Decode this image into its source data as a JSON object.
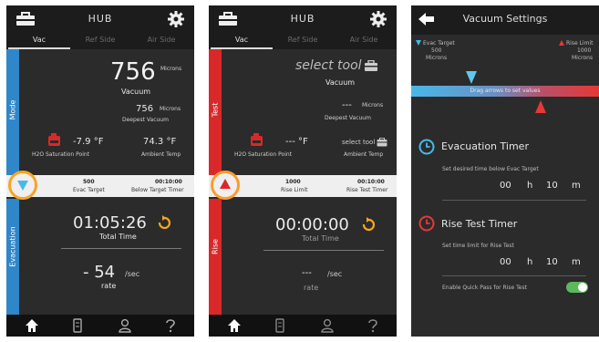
{
  "colors": {
    "vac_blue": "#2f86c8",
    "test_red": "#d9282a",
    "accent_orange": "#f5a623",
    "background": "#2b2b2b",
    "toggle_green": "#5cb85c"
  },
  "screen1": {
    "header_title": "HUB",
    "tabs": [
      "Vac",
      "Ref Side",
      "Air Side"
    ],
    "vacuum_value": "756",
    "vacuum_unit": "Microns",
    "vacuum_label": "Vacuum",
    "deepest_value": "756",
    "deepest_unit": "Microns",
    "deepest_label": "Deepest Vacuum",
    "h2o_value": "-7.9 °F",
    "h2o_label": "H2O Saturation Point",
    "ambient_value": "74.3 °F",
    "ambient_label": "Ambient Temp",
    "band_left_value": "500",
    "band_left_label": "Evac Target",
    "band_right_value": "00:10:00",
    "band_right_label": "Below Target Timer",
    "mode_label": "Mode",
    "phase_label": "Evacuation",
    "total_time_value": "01:05:26",
    "total_time_label": "Total Time",
    "rate_value": "- 54",
    "rate_unit": "/sec",
    "rate_label": "rate"
  },
  "screen2": {
    "header_title": "HUB",
    "tabs": [
      "Vac",
      "Ref Side",
      "Air Side"
    ],
    "select_tool": "select tool",
    "vacuum_label": "Vacuum",
    "deepest_value": "---",
    "deepest_unit": "Microns",
    "deepest_label": "Deepest Vacuum",
    "h2o_value": "--- °F",
    "h2o_label": "H2O Saturation Point",
    "ambient_value": "select tool",
    "ambient_label": "Ambient Temp",
    "band_left_value": "1000",
    "band_left_label": "Rise Limit",
    "band_right_value": "00:10:00",
    "band_right_label": "Rise Test Timer",
    "test_label": "Test",
    "rise_label": "Rise",
    "total_time_value": "00:00:00",
    "total_time_label": "Total Time",
    "rate_value": "---",
    "rate_unit": "/sec",
    "rate_label": "rate"
  },
  "screen3": {
    "title": "Vacuum Settings",
    "evac_target_label": "Evac Target",
    "evac_target_value": "500",
    "evac_target_unit": "Microns",
    "rise_limit_label": "Rise Limit",
    "rise_limit_value": "1000",
    "rise_limit_unit": "Microns",
    "drag_hint": "Drag arrows to set values",
    "evac_timer_title": "Evacuation Timer",
    "evac_timer_desc": "Set desired time below Evac Target",
    "evac_hours": "00",
    "evac_h": "h",
    "evac_minutes": "10",
    "evac_m": "m",
    "rise_timer_title": "Rise Test Timer",
    "rise_timer_desc": "Set time limit for Rise Test",
    "rise_hours": "00",
    "rise_h": "h",
    "rise_minutes": "10",
    "rise_m": "m",
    "quick_pass_label": "Enable Quick Pass for Rise Test",
    "quick_pass_enabled": true
  },
  "icons": {
    "toolbox": "toolbox-icon",
    "gear": "gear-icon",
    "home": "home-icon",
    "gauge": "gauge-icon",
    "user": "user-icon",
    "help": "help-icon",
    "back": "back-arrow-icon",
    "clock": "clock-icon",
    "refresh": "refresh-icon",
    "triangle_down": "triangle-down-icon",
    "triangle_up": "triangle-up-icon"
  }
}
